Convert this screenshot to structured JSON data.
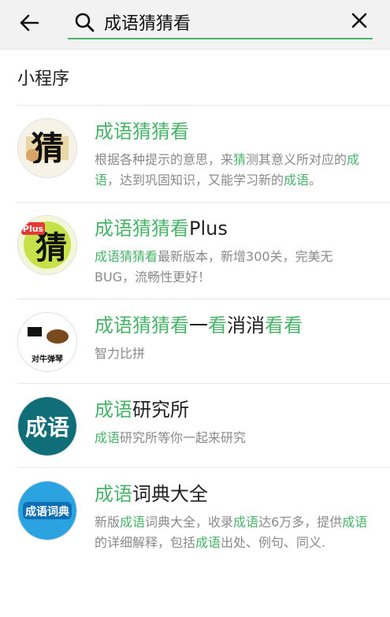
{
  "header": {
    "search_value": "成语猜猜看"
  },
  "section": {
    "title": "小程序"
  },
  "results": [
    {
      "title_parts": [
        {
          "t": "成语猜猜看",
          "hl": true
        }
      ],
      "desc_parts": [
        {
          "t": "根据各种提示的意思，来",
          "hl": false
        },
        {
          "t": "猜",
          "hl": true
        },
        {
          "t": "测其意义所对应的",
          "hl": false
        },
        {
          "t": "成语",
          "hl": true
        },
        {
          "t": "，达到巩固知识，又能学习新的",
          "hl": false
        },
        {
          "t": "成语",
          "hl": true
        },
        {
          "t": "。",
          "hl": false
        }
      ],
      "avatar": {
        "text": "猜"
      }
    },
    {
      "title_parts": [
        {
          "t": "成语猜猜看",
          "hl": true
        },
        {
          "t": "Plus",
          "hl": false
        }
      ],
      "desc_parts": [
        {
          "t": "成语猜猜看",
          "hl": true
        },
        {
          "t": "最新版本，新增300关，完美无BUG，流畅性更好！",
          "hl": false
        }
      ],
      "avatar": {
        "text": "猜",
        "badge": "Plus"
      }
    },
    {
      "title_parts": [
        {
          "t": "成语猜猜看",
          "hl": true
        },
        {
          "t": "一",
          "hl": false
        },
        {
          "t": "看",
          "hl": true
        },
        {
          "t": "消消",
          "hl": false
        },
        {
          "t": "看看",
          "hl": true
        }
      ],
      "desc_parts": [
        {
          "t": "智力比拼",
          "hl": false
        }
      ],
      "avatar": {
        "text": "对牛弹琴"
      }
    },
    {
      "title_parts": [
        {
          "t": "成语",
          "hl": true
        },
        {
          "t": "研究所",
          "hl": false
        }
      ],
      "desc_parts": [
        {
          "t": "成语",
          "hl": true
        },
        {
          "t": "研究所等你一起来研究",
          "hl": false
        }
      ],
      "avatar": {
        "text": "成语"
      }
    },
    {
      "title_parts": [
        {
          "t": "成语",
          "hl": true
        },
        {
          "t": "词典大全",
          "hl": false
        }
      ],
      "desc_parts": [
        {
          "t": "新版",
          "hl": false
        },
        {
          "t": "成语",
          "hl": true
        },
        {
          "t": "词典大全，收录",
          "hl": false
        },
        {
          "t": "成语",
          "hl": true
        },
        {
          "t": "达6万多，提供",
          "hl": false
        },
        {
          "t": "成语",
          "hl": true
        },
        {
          "t": "的详细解释，包括",
          "hl": false
        },
        {
          "t": "成语",
          "hl": true
        },
        {
          "t": "出处、例句、同义.",
          "hl": false
        }
      ],
      "avatar": {
        "text": "成语词典"
      }
    }
  ],
  "colors": {
    "accent": "#49b36a",
    "muted": "#8a8a8a"
  }
}
